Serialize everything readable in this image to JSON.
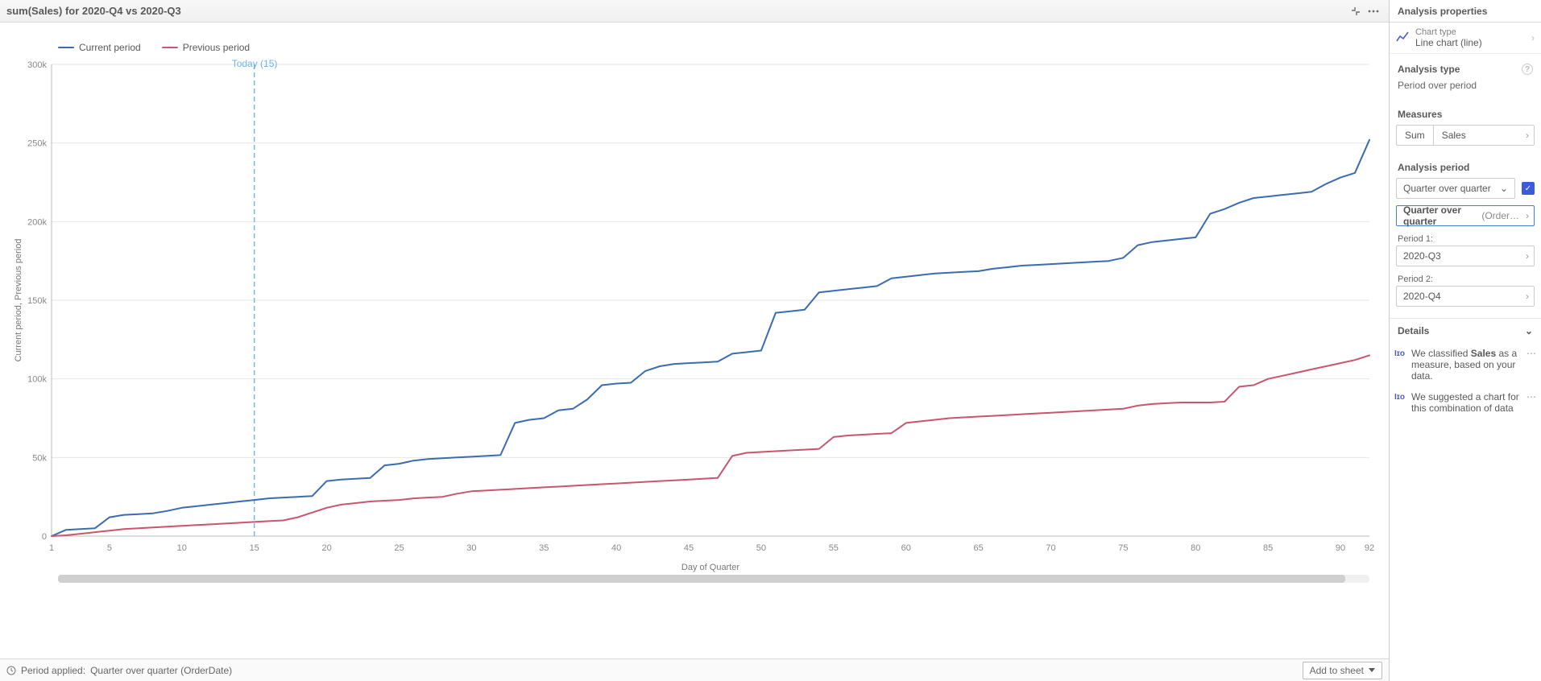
{
  "header": {
    "title": "sum(Sales) for 2020-Q4 vs 2020-Q3"
  },
  "legend": {
    "series_a": "Current period",
    "series_b": "Previous period"
  },
  "today_marker": {
    "label": "Today (15)",
    "x_value": 15
  },
  "axes": {
    "x_label": "Day of Quarter",
    "y_label": "Current period, Previous period"
  },
  "footer": {
    "period_label": "Period applied:",
    "period_value": "Quarter over quarter (OrderDate)",
    "add_button": "Add to sheet"
  },
  "sidepanel": {
    "title": "Analysis properties",
    "chart_type_label": "Chart type",
    "chart_type_value": "Line chart (line)",
    "analysis_type_label": "Analysis type",
    "analysis_type_value": "Period over period",
    "measures_label": "Measures",
    "measures_agg": "Sum",
    "measures_field": "Sales",
    "analysis_period_label": "Analysis period",
    "period_mode": "Quarter over quarter",
    "period_calendar_prefix": "Quarter over quarter",
    "period_calendar_suffix": "(Order…",
    "period1_label": "Period 1:",
    "period1_value": "2020-Q3",
    "period2_label": "Period 2:",
    "period2_value": "2020-Q4",
    "details_label": "Details",
    "detail1_pre": "We classified ",
    "detail1_bold": "Sales",
    "detail1_post": " as a measure, based on your data.",
    "detail2": "We suggested a chart for this combination of data"
  },
  "chart_data": {
    "type": "line",
    "xlabel": "Day of Quarter",
    "ylabel": "Current period, Previous period",
    "x_range": [
      1,
      92
    ],
    "x_ticks": [
      1,
      5,
      10,
      15,
      20,
      25,
      30,
      35,
      40,
      45,
      50,
      55,
      60,
      65,
      70,
      75,
      80,
      85,
      90,
      92
    ],
    "ylim": [
      0,
      300000
    ],
    "y_ticks": [
      0,
      50000,
      100000,
      150000,
      200000,
      250000,
      300000
    ],
    "y_tick_labels": [
      "0",
      "50k",
      "100k",
      "150k",
      "200k",
      "250k",
      "300k"
    ],
    "reference_line": {
      "x": 15,
      "label": "Today (15)"
    },
    "series": [
      {
        "name": "Current period",
        "color": "#3b6bb0",
        "x": [
          1,
          2,
          3,
          4,
          5,
          6,
          7,
          8,
          9,
          10,
          11,
          12,
          13,
          14,
          15,
          16,
          17,
          18,
          19,
          20,
          21,
          22,
          23,
          24,
          25,
          26,
          27,
          28,
          29,
          30,
          31,
          32,
          33,
          34,
          35,
          36,
          37,
          38,
          39,
          40,
          41,
          42,
          43,
          44,
          45,
          46,
          47,
          48,
          49,
          50,
          51,
          52,
          53,
          54,
          55,
          56,
          57,
          58,
          59,
          60,
          61,
          62,
          63,
          64,
          65,
          66,
          67,
          68,
          69,
          70,
          71,
          72,
          73,
          74,
          75,
          76,
          77,
          78,
          79,
          80,
          81,
          82,
          83,
          84,
          85,
          86,
          87,
          88,
          89,
          90,
          91,
          92
        ],
        "values": [
          0,
          4000,
          4500,
          5000,
          12000,
          13500,
          14000,
          14500,
          16000,
          18000,
          19000,
          20000,
          21000,
          22000,
          23000,
          24000,
          24500,
          25000,
          25500,
          35000,
          36000,
          36500,
          37000,
          45000,
          46000,
          48000,
          49000,
          49500,
          50000,
          50500,
          51000,
          51500,
          72000,
          74000,
          75000,
          80000,
          81000,
          87000,
          96000,
          97000,
          97500,
          105000,
          108000,
          109500,
          110000,
          110500,
          111000,
          116000,
          117000,
          118000,
          142000,
          143000,
          144000,
          155000,
          156000,
          157000,
          158000,
          159000,
          164000,
          165000,
          166000,
          167000,
          167500,
          168000,
          168500,
          170000,
          171000,
          172000,
          172500,
          173000,
          173500,
          174000,
          174500,
          175000,
          177000,
          185000,
          187000,
          188000,
          189000,
          190000,
          205000,
          208000,
          212000,
          215000,
          216000,
          217000,
          218000,
          219000,
          224000,
          228000,
          231000,
          252000
        ],
        "legend_label": "Current period"
      },
      {
        "name": "Previous period",
        "color": "#c9556e",
        "x": [
          1,
          2,
          3,
          4,
          5,
          6,
          7,
          8,
          9,
          10,
          11,
          12,
          13,
          14,
          15,
          16,
          17,
          18,
          19,
          20,
          21,
          22,
          23,
          24,
          25,
          26,
          27,
          28,
          29,
          30,
          31,
          32,
          33,
          34,
          35,
          36,
          37,
          38,
          39,
          40,
          41,
          42,
          43,
          44,
          45,
          46,
          47,
          48,
          49,
          50,
          51,
          52,
          53,
          54,
          55,
          56,
          57,
          58,
          59,
          60,
          61,
          62,
          63,
          64,
          65,
          66,
          67,
          68,
          69,
          70,
          71,
          72,
          73,
          74,
          75,
          76,
          77,
          78,
          79,
          80,
          81,
          82,
          83,
          84,
          85,
          86,
          87,
          88,
          89,
          90,
          91,
          92
        ],
        "values": [
          0,
          500,
          1500,
          2500,
          3500,
          4500,
          5000,
          5500,
          6000,
          6500,
          7000,
          7500,
          8000,
          8500,
          9000,
          9500,
          10000,
          12000,
          15000,
          18000,
          20000,
          21000,
          22000,
          22500,
          23000,
          24000,
          24500,
          25000,
          27000,
          28500,
          29000,
          29500,
          30000,
          30500,
          31000,
          31500,
          32000,
          32500,
          33000,
          33500,
          34000,
          34500,
          35000,
          35500,
          36000,
          36500,
          37000,
          51000,
          53000,
          53500,
          54000,
          54500,
          55000,
          55500,
          63000,
          64000,
          64500,
          65000,
          65500,
          72000,
          73000,
          74000,
          75000,
          75500,
          76000,
          76500,
          77000,
          77500,
          78000,
          78500,
          79000,
          79500,
          80000,
          80500,
          81000,
          83000,
          84000,
          84500,
          85000,
          85000,
          85000,
          85500,
          95000,
          96000,
          100000,
          102000,
          104000,
          106000,
          108000,
          110000,
          112000,
          115000
        ],
        "legend_label": "Previous period"
      }
    ]
  }
}
